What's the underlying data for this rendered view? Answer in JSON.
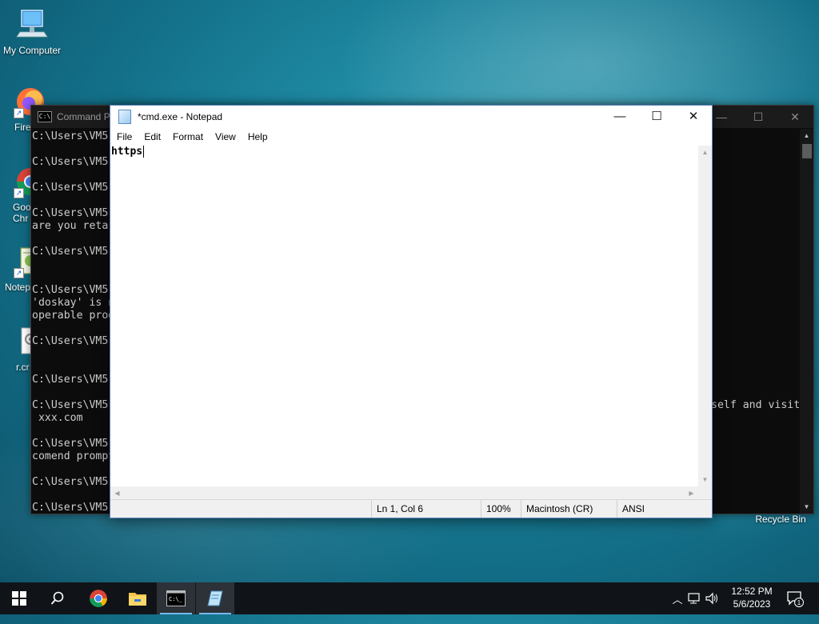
{
  "desktop": {
    "icons": [
      {
        "label": "My Computer"
      },
      {
        "label": "Fire"
      },
      {
        "label": "Goo\nChr"
      },
      {
        "label": "Notep"
      },
      {
        "label": "r.cr"
      }
    ],
    "recycle_bin": "Recycle Bin"
  },
  "cmd_window": {
    "title": "Command P",
    "lines": [
      "C:\\Users\\VM5",
      "C:\\Users\\VM5",
      "C:\\Users\\VM5",
      "C:\\Users\\VM5",
      "are you retar",
      "C:\\Users\\VM5",
      "C:\\Users\\VM5",
      "'doskay' is n",
      "operable prog",
      "C:\\Users\\VM5",
      "C:\\Users\\VM5",
      "C:\\Users\\VM5",
      " xxx.com",
      "C:\\Users\\VM5",
      "comend prompt",
      "C:\\Users\\VM5",
      "C:\\Users\\VM5"
    ],
    "right_text": "self and visit"
  },
  "notepad": {
    "title": "*cmd.exe - Notepad",
    "menu": [
      "File",
      "Edit",
      "Format",
      "View",
      "Help"
    ],
    "content": "https",
    "status": {
      "position": "Ln 1, Col 6",
      "zoom": "100%",
      "line_ending": "Macintosh (CR)",
      "encoding": "ANSI"
    }
  },
  "taskbar": {
    "time": "12:52 PM",
    "date": "5/6/2023",
    "notification_count": "1"
  }
}
